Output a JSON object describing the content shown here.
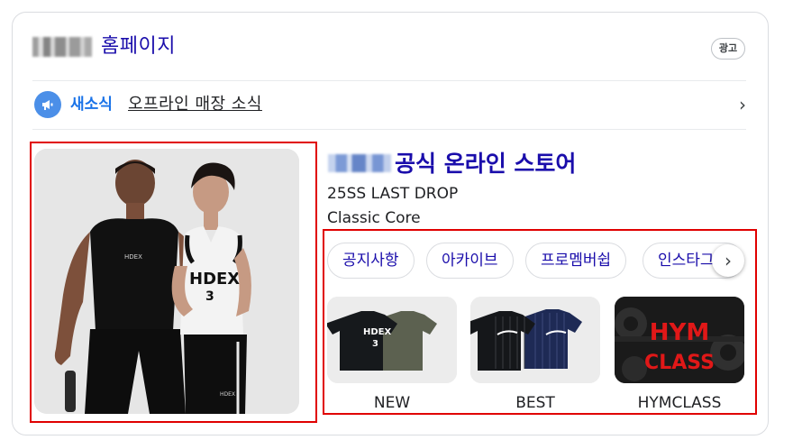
{
  "header": {
    "brand_blurred": "",
    "home_label": "홈페이지",
    "ad_badge": "광고"
  },
  "news": {
    "label": "새소식",
    "link_text": "오프라인 매장 소식",
    "icon": "megaphone-icon"
  },
  "hero": {
    "tank_logo_man": "HDEX",
    "tank_logo_woman": "HDEX",
    "tank_number": "3",
    "pants_logo": "HDEX"
  },
  "store": {
    "title": "공식 온라인 스토어",
    "subtitle_1": "25SS LAST DROP",
    "subtitle_2": "Classic Core"
  },
  "chips": [
    "공지사항",
    "아카이브",
    "프로멤버쉽",
    "인스타그램"
  ],
  "products": [
    {
      "label": "NEW",
      "print": "HDEX",
      "number": "3"
    },
    {
      "label": "BEST"
    },
    {
      "label": "HYMCLASS",
      "graphic_text": "HYM CLASS"
    }
  ],
  "colors": {
    "link_blue": "#1a0dab",
    "accent_blue": "#1a73e8",
    "highlight_red": "#e00000"
  }
}
